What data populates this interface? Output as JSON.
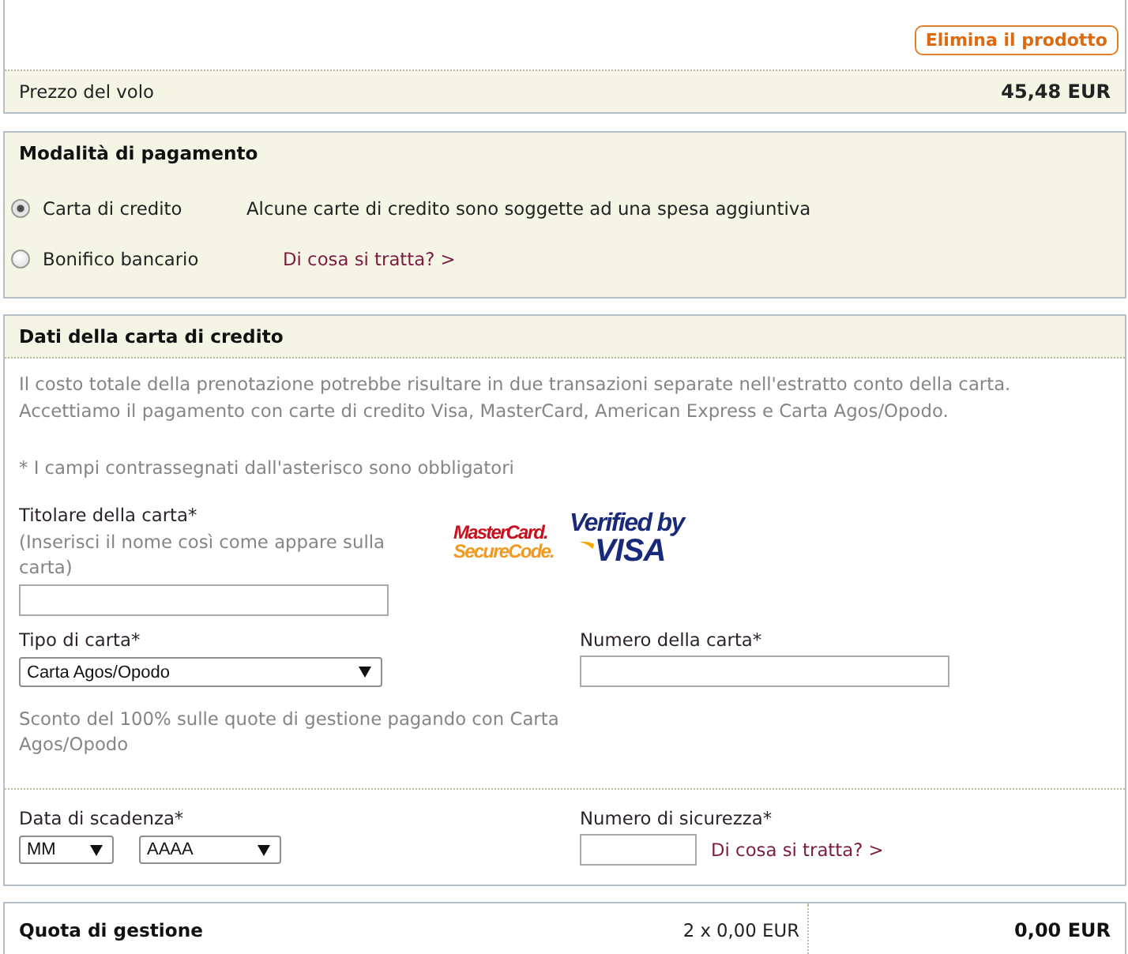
{
  "product": {
    "remove_button": "Elimina il prodotto",
    "price_label": "Prezzo del volo",
    "price": "45,48 EUR"
  },
  "payment_method": {
    "title": "Modalità di pagamento",
    "options": [
      {
        "label": "Carta di credito",
        "selected": true,
        "note": "Alcune carte di credito sono soggette ad una spesa aggiuntiva"
      },
      {
        "label": "Bonifico bancario",
        "selected": false,
        "link": "Di cosa si tratta? >"
      }
    ]
  },
  "card_details": {
    "title": "Dati della carta di credito",
    "intro": [
      "Il costo totale della prenotazione potrebbe risultare in due transazioni separate nell'estratto conto della carta.",
      "Accettiamo il pagamento con carte di credito Visa, MasterCard, American Express e Carta Agos/Opodo."
    ],
    "required_note": "* I campi contrassegnati dall'asterisco sono obbligatori",
    "holder": {
      "label": "Titolare della carta*",
      "hint": "(Inserisci il nome così come appare sulla carta)"
    },
    "logos": [
      {
        "kind": "mastercard",
        "lines": [
          "MasterCard.",
          "SecureCode."
        ]
      },
      {
        "kind": "visa",
        "lines": [
          "Verified by",
          "VISA"
        ]
      }
    ],
    "card_type": {
      "label": "Tipo di carta*",
      "value": "Carta Agos/Opodo"
    },
    "card_number": {
      "label": "Numero della carta*"
    },
    "discount_note": "Sconto del 100% sulle quote di gestione pagando con Carta Agos/Opodo",
    "expiry": {
      "label": "Data di scadenza*",
      "month": "MM",
      "year": "AAAA"
    },
    "security_code": {
      "label": "Numero di sicurezza*",
      "link": "Di cosa si tratta? >"
    }
  },
  "fee": {
    "label": "Quota di gestione",
    "detail": "2 x 0,00 EUR",
    "total": "0,00 EUR"
  }
}
